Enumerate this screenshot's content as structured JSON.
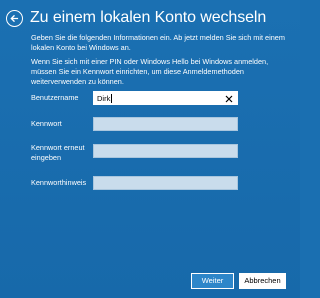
{
  "header": {
    "title": "Zu einem lokalen Konto wechseln",
    "back_icon": "back-arrow-icon"
  },
  "intro": {
    "paragraph1": "Geben Sie die folgenden Informationen ein. Ab jetzt melden Sie sich mit einem lokalen Konto bei Windows an.",
    "paragraph2": "Wenn Sie sich mit einer PIN oder Windows Hello bei Windows anmelden, müssen Sie ein Kennwort einrichten, um diese Anmeldemethoden weiterverwenden zu können."
  },
  "form": {
    "username": {
      "label": "Benutzername",
      "value": "Dirk",
      "clear_icon": "close-icon"
    },
    "password": {
      "label": "Kennwort",
      "value": ""
    },
    "password_confirm": {
      "label": "Kennwort erneut eingeben",
      "value": ""
    },
    "password_hint": {
      "label": "Kennworthinweis",
      "value": ""
    }
  },
  "buttons": {
    "next_label": "Weiter",
    "cancel_label": "Abbrechen"
  },
  "colors": {
    "background": "#1a6fb1",
    "input_inactive": "#c9dcec",
    "input_active": "#ffffff",
    "primary_button": "#2d86c9"
  }
}
